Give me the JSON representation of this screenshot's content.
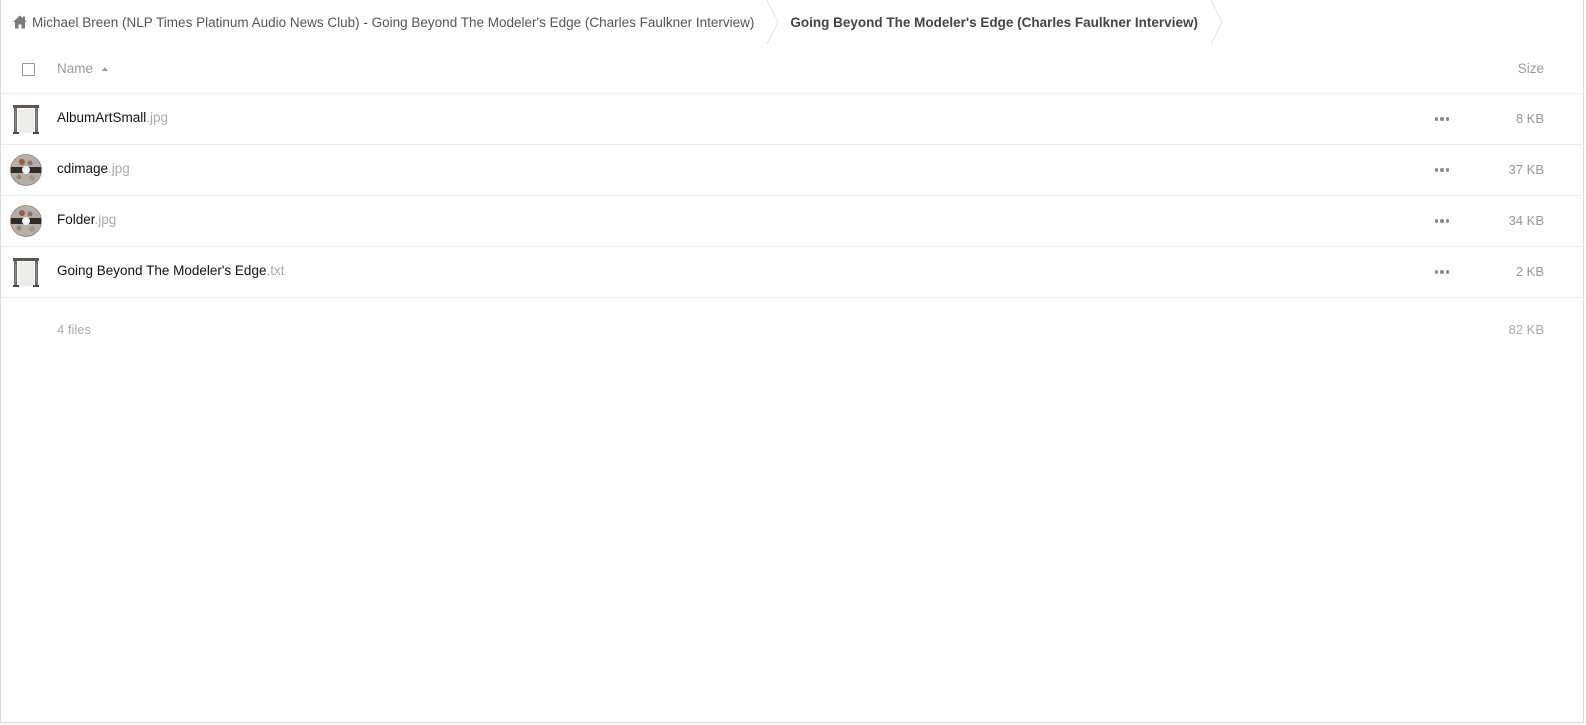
{
  "breadcrumb": {
    "home_icon": "home-icon",
    "items": [
      {
        "label": "Michael Breen (NLP Times Platinum Audio News Club) - Going Beyond The Modeler's Edge (Charles Faulkner Interview)"
      },
      {
        "label": "Going Beyond The Modeler's Edge (Charles Faulkner Interview)"
      }
    ]
  },
  "table": {
    "headers": {
      "name": "Name",
      "size": "Size"
    },
    "sort": "name-ascending",
    "files": [
      {
        "name": "AlbumArtSmall",
        "ext": ".jpg",
        "size": "8 KB",
        "thumbnail": "album-art-thumbnail"
      },
      {
        "name": "cdimage",
        "ext": ".jpg",
        "size": "37 KB",
        "thumbnail": "cd-image-thumbnail"
      },
      {
        "name": "Folder",
        "ext": ".jpg",
        "size": "34 KB",
        "thumbnail": "cd-image-thumbnail"
      },
      {
        "name": "Going Beyond The Modeler's Edge",
        "ext": ".txt",
        "size": "2 KB",
        "thumbnail": "album-art-thumbnail"
      }
    ],
    "summary": {
      "count": "4 files",
      "total_size": "82 KB"
    }
  },
  "colors": {
    "text": "#111111",
    "muted": "#999999",
    "divider": "#ededed"
  }
}
